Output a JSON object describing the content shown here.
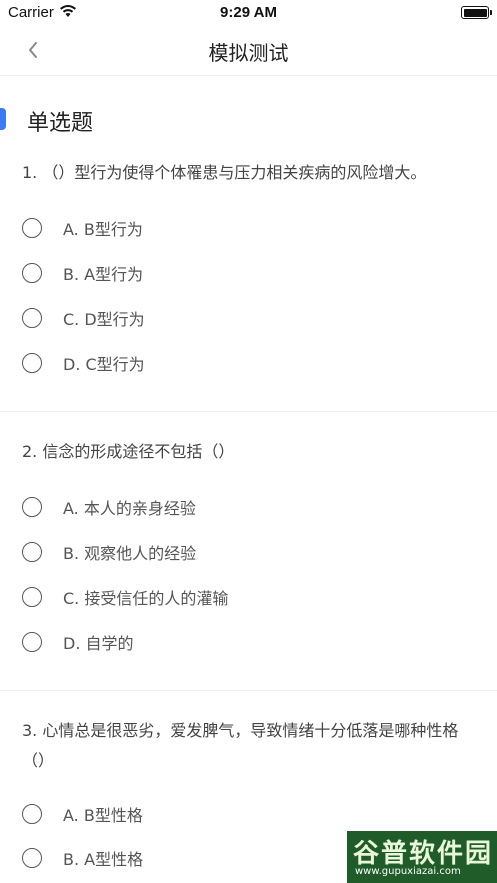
{
  "status_bar": {
    "carrier": "Carrier",
    "time": "9:29 AM"
  },
  "nav": {
    "title": "模拟测试"
  },
  "section": {
    "title": "单选题"
  },
  "questions": [
    {
      "text": "1. （）型行为使得个体罹患与压力相关疾病的风险增大。",
      "options": [
        "A. B型行为",
        "B. A型行为",
        "C. D型行为",
        "D. C型行为"
      ]
    },
    {
      "text": "2. 信念的形成途径不包括（）",
      "options": [
        "A. 本人的亲身经验",
        "B. 观察他人的经验",
        "C. 接受信任的人的灌输",
        "D. 自学的"
      ]
    },
    {
      "text": "3. 心情总是很恶劣，爱发脾气，导致情绪十分低落是哪种性格（）",
      "options": [
        "A. B型性格",
        "B. A型性格"
      ]
    }
  ],
  "watermark": {
    "title": "谷普软件园",
    "url": "www.gupuxiazai.com"
  }
}
